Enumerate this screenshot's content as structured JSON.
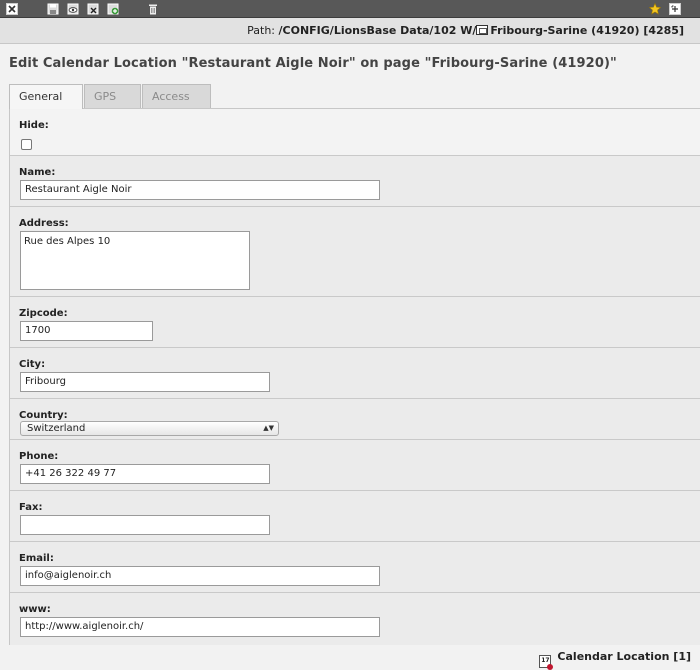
{
  "toolbar": {
    "icons": [
      "close-icon",
      "save-icon",
      "save-and-view-icon",
      "save-and-close-icon",
      "save-and-new-icon",
      "delete-icon",
      "shortcut-star-icon",
      "open-new-window-icon"
    ]
  },
  "path": {
    "label": "Path:",
    "folder": "/CONFIG/LionsBase Data/102 W/",
    "page": "Fribourg-Sarine (41920) [4285]"
  },
  "page_title": "Edit Calendar Location \"Restaurant Aigle Noir\" on page \"Fribourg-Sarine (41920)\"",
  "tabs": [
    {
      "label": "General",
      "active": true
    },
    {
      "label": "GPS",
      "active": false
    },
    {
      "label": "Access",
      "active": false
    }
  ],
  "fields": {
    "hide": {
      "label": "Hide:",
      "checked": false
    },
    "name": {
      "label": "Name:",
      "value": "Restaurant Aigle Noir"
    },
    "address": {
      "label": "Address:",
      "value": "Rue des Alpes 10"
    },
    "zipcode": {
      "label": "Zipcode:",
      "value": "1700"
    },
    "city": {
      "label": "City:",
      "value": "Fribourg"
    },
    "country": {
      "label": "Country:",
      "value": "Switzerland"
    },
    "phone": {
      "label": "Phone:",
      "value": "+41 26 322 49 77"
    },
    "fax": {
      "label": "Fax:",
      "value": ""
    },
    "email": {
      "label": "Email:",
      "value": "info@aiglenoir.ch"
    },
    "www": {
      "label": "www:",
      "value": "http://www.aiglenoir.ch/"
    }
  },
  "footer": {
    "record_ref": "Calendar Location [1]",
    "calendar_icon_day": "17"
  },
  "colors": {
    "toolbar": "#585858",
    "form_bg": "#ebebeb"
  }
}
